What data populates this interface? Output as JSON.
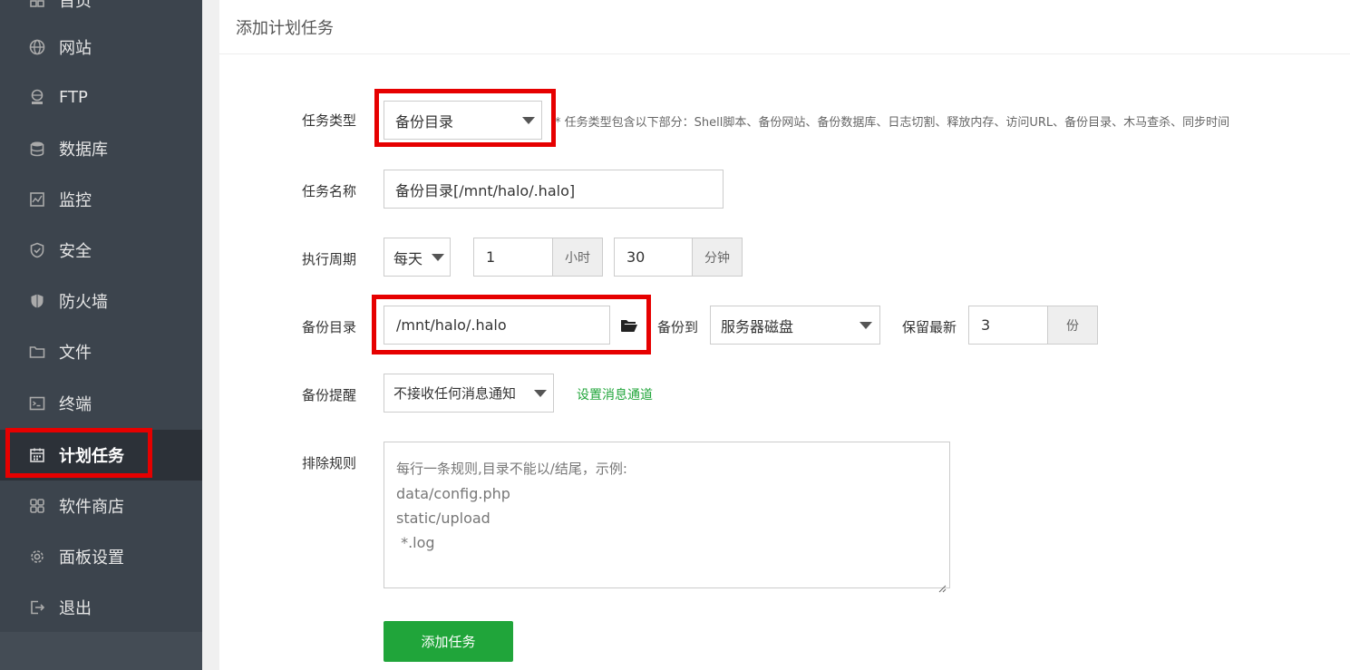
{
  "sidebar": {
    "items": [
      {
        "label": "首页",
        "icon": "home-icon"
      },
      {
        "label": "网站",
        "icon": "globe-icon"
      },
      {
        "label": "FTP",
        "icon": "ftp-icon"
      },
      {
        "label": "数据库",
        "icon": "database-icon"
      },
      {
        "label": "监控",
        "icon": "monitor-icon"
      },
      {
        "label": "安全",
        "icon": "shield-check-icon"
      },
      {
        "label": "防火墙",
        "icon": "firewall-shield-icon"
      },
      {
        "label": "文件",
        "icon": "folder-icon"
      },
      {
        "label": "终端",
        "icon": "terminal-icon"
      },
      {
        "label": "计划任务",
        "icon": "calendar-icon",
        "active": true
      },
      {
        "label": "软件商店",
        "icon": "apps-grid-icon"
      },
      {
        "label": "面板设置",
        "icon": "gear-icon"
      },
      {
        "label": "退出",
        "icon": "logout-icon"
      }
    ]
  },
  "page": {
    "title": "添加计划任务"
  },
  "form": {
    "task_type": {
      "label": "任务类型",
      "value": "备份目录",
      "hint": "* 任务类型包含以下部分：Shell脚本、备份网站、备份数据库、日志切割、释放内存、访问URL、备份目录、木马查杀、同步时间"
    },
    "task_name": {
      "label": "任务名称",
      "value": "备份目录[/mnt/halo/.halo]"
    },
    "cycle": {
      "label": "执行周期",
      "period": "每天",
      "hour_value": "1",
      "hour_unit": "小时",
      "minute_value": "30",
      "minute_unit": "分钟"
    },
    "backup_dir": {
      "label": "备份目录",
      "value": "/mnt/halo/.halo",
      "backup_to_label": "备份到",
      "backup_to_value": "服务器磁盘",
      "keep_label": "保留最新",
      "keep_value": "3",
      "keep_unit": "份"
    },
    "notify": {
      "label": "备份提醒",
      "value": "不接收任何消息通知",
      "link": "设置消息通道"
    },
    "exclude": {
      "label": "排除规则",
      "placeholder_lines": [
        "每行一条规则,目录不能以/结尾，示例:",
        "data/config.php",
        "static/upload",
        " *.log"
      ]
    },
    "submit_label": "添加任务"
  },
  "colors": {
    "sidebar_bg": "#3c444d",
    "sidebar_active_bg": "#2c3138",
    "accent_green": "#20a53a",
    "highlight_red": "#e60000"
  }
}
